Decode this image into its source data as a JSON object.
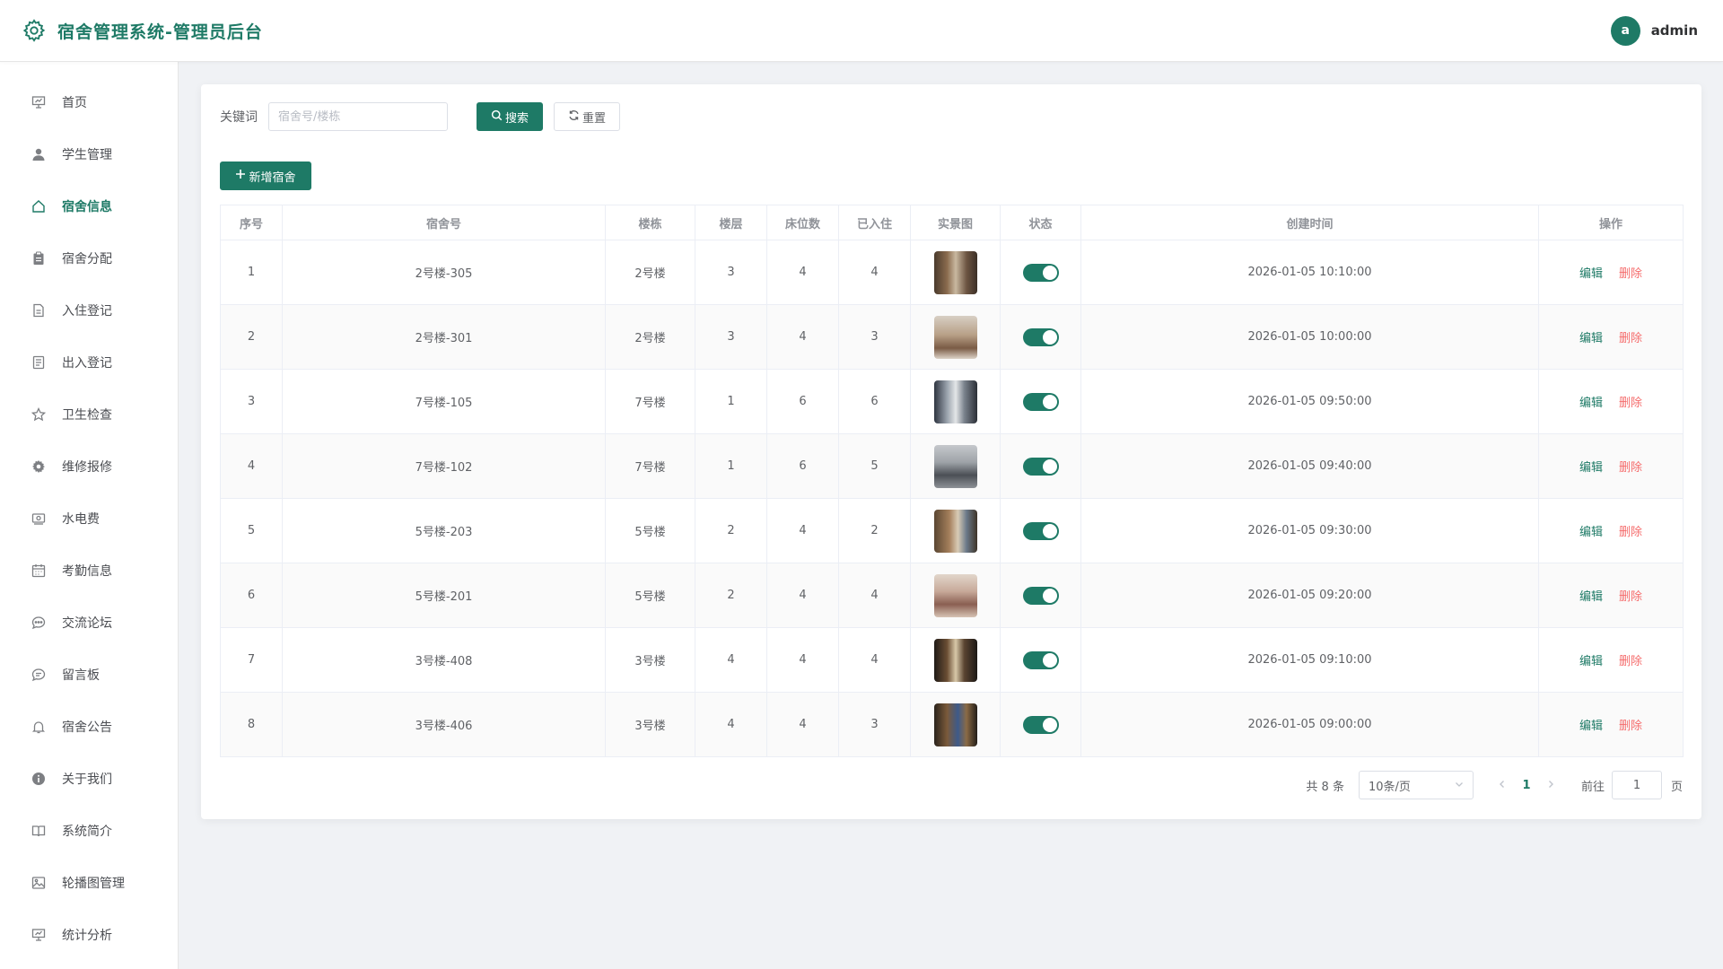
{
  "header": {
    "title": "宿舍管理系统-管理员后台",
    "avatar_letter": "a",
    "username": "admin"
  },
  "colors": {
    "accent": "#1e7a66",
    "danger": "#f56c6c"
  },
  "sidebar": {
    "items": [
      {
        "label": "首页",
        "icon": "presentation-icon"
      },
      {
        "label": "学生管理",
        "icon": "user-icon"
      },
      {
        "label": "宿舍信息",
        "icon": "home-icon",
        "active": true
      },
      {
        "label": "宿舍分配",
        "icon": "clipboard-icon"
      },
      {
        "label": "入住登记",
        "icon": "document-icon"
      },
      {
        "label": "出入登记",
        "icon": "tickets-icon"
      },
      {
        "label": "卫生检查",
        "icon": "star-icon"
      },
      {
        "label": "维修报修",
        "icon": "gear-icon"
      },
      {
        "label": "水电费",
        "icon": "money-icon"
      },
      {
        "label": "考勤信息",
        "icon": "calendar-icon"
      },
      {
        "label": "交流论坛",
        "icon": "chat-dots-icon"
      },
      {
        "label": "留言板",
        "icon": "chat-line-icon"
      },
      {
        "label": "宿舍公告",
        "icon": "bell-icon"
      },
      {
        "label": "关于我们",
        "icon": "info-icon"
      },
      {
        "label": "系统简介",
        "icon": "book-icon"
      },
      {
        "label": "轮播图管理",
        "icon": "picture-icon"
      },
      {
        "label": "统计分析",
        "icon": "chart-board-icon"
      }
    ]
  },
  "search": {
    "label": "关键词",
    "placeholder": "宿舍号/楼栋",
    "search_btn": "搜索",
    "reset_btn": "重置"
  },
  "add_btn": "新增宿舍",
  "table": {
    "columns": [
      "序号",
      "宿舍号",
      "楼栋",
      "楼层",
      "床位数",
      "已入住",
      "实景图",
      "状态",
      "创建时间",
      "操作"
    ],
    "edit_label": "编辑",
    "delete_label": "删除",
    "rows": [
      {
        "no": "1",
        "room": "2号楼-305",
        "building": "2号楼",
        "floor": "3",
        "beds": "4",
        "occupied": "4",
        "enabled": true,
        "created": "2026-01-05 10:10:00"
      },
      {
        "no": "2",
        "room": "2号楼-301",
        "building": "2号楼",
        "floor": "3",
        "beds": "4",
        "occupied": "3",
        "enabled": true,
        "created": "2026-01-05 10:00:00"
      },
      {
        "no": "3",
        "room": "7号楼-105",
        "building": "7号楼",
        "floor": "1",
        "beds": "6",
        "occupied": "6",
        "enabled": true,
        "created": "2026-01-05 09:50:00"
      },
      {
        "no": "4",
        "room": "7号楼-102",
        "building": "7号楼",
        "floor": "1",
        "beds": "6",
        "occupied": "5",
        "enabled": true,
        "created": "2026-01-05 09:40:00"
      },
      {
        "no": "5",
        "room": "5号楼-203",
        "building": "5号楼",
        "floor": "2",
        "beds": "4",
        "occupied": "2",
        "enabled": true,
        "created": "2026-01-05 09:30:00"
      },
      {
        "no": "6",
        "room": "5号楼-201",
        "building": "5号楼",
        "floor": "2",
        "beds": "4",
        "occupied": "4",
        "enabled": true,
        "created": "2026-01-05 09:20:00"
      },
      {
        "no": "7",
        "room": "3号楼-408",
        "building": "3号楼",
        "floor": "4",
        "beds": "4",
        "occupied": "4",
        "enabled": true,
        "created": "2026-01-05 09:10:00"
      },
      {
        "no": "8",
        "room": "3号楼-406",
        "building": "3号楼",
        "floor": "4",
        "beds": "4",
        "occupied": "3",
        "enabled": true,
        "created": "2026-01-05 09:00:00"
      }
    ]
  },
  "pagination": {
    "total": "共 8 条",
    "page_size": "10条/页",
    "current_page": "1",
    "goto_label": "前往",
    "goto_value": "1",
    "page_suffix": "页"
  }
}
